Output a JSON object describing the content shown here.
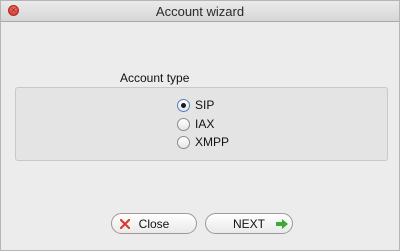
{
  "window": {
    "title": "Account wizard"
  },
  "account_type": {
    "label": "Account type",
    "options": [
      {
        "label": "SIP",
        "checked": true
      },
      {
        "label": "IAX",
        "checked": false
      },
      {
        "label": "XMPP",
        "checked": false
      }
    ]
  },
  "buttons": {
    "close_label": "Close",
    "next_label": "NEXT"
  },
  "icons": {
    "close": "x-icon",
    "next": "arrow-right-icon",
    "close_color": "#d93a32",
    "next_color": "#3ea83a"
  }
}
